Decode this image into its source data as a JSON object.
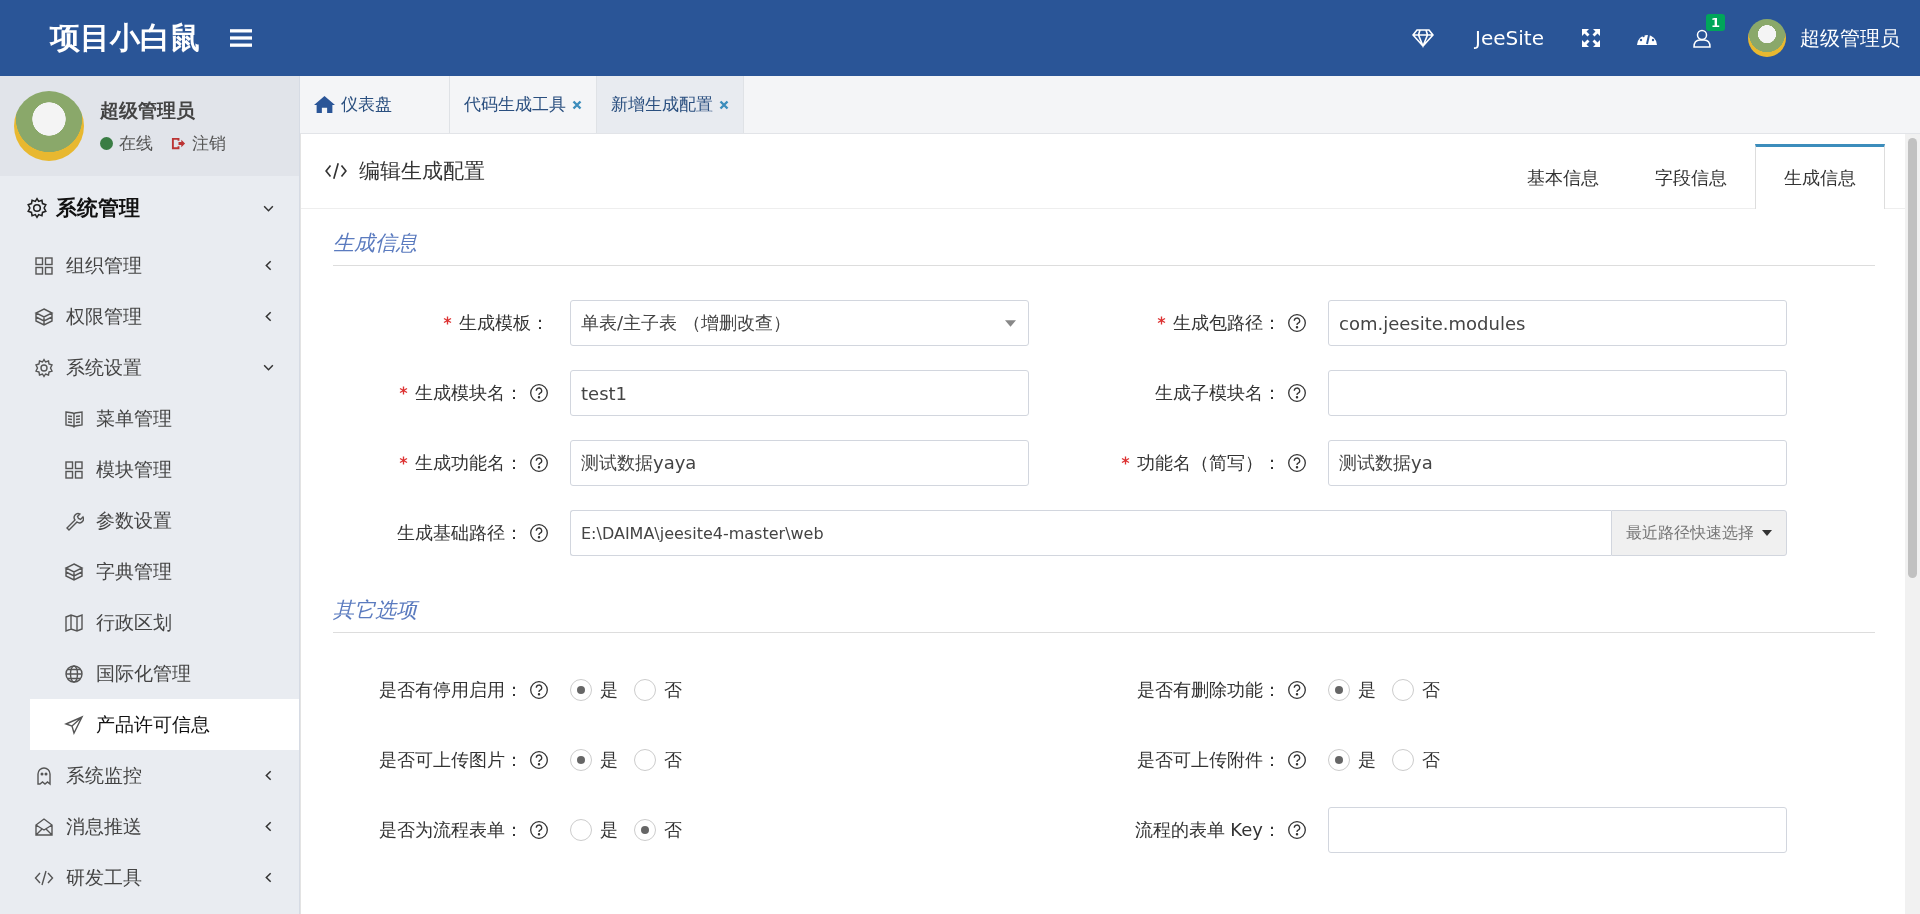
{
  "header": {
    "title": "项目小白鼠",
    "brand": "JeeSite",
    "notification_count": "1",
    "user": "超级管理员"
  },
  "user_panel": {
    "name": "超级管理员",
    "status": "在线",
    "logout": "注销"
  },
  "sidebar": {
    "items": [
      {
        "label": "系统管理",
        "expanded": true,
        "children": [
          {
            "label": "组织管理",
            "expanded": false
          },
          {
            "label": "权限管理",
            "expanded": false
          },
          {
            "label": "系统设置",
            "expanded": true,
            "children": [
              {
                "label": "菜单管理",
                "selected": false
              },
              {
                "label": "模块管理",
                "selected": false
              },
              {
                "label": "参数设置",
                "selected": false
              },
              {
                "label": "字典管理",
                "selected": false
              },
              {
                "label": "行政区划",
                "selected": false
              },
              {
                "label": "国际化管理",
                "selected": false
              },
              {
                "label": "产品许可信息",
                "selected": true
              }
            ]
          },
          {
            "label": "系统监控",
            "expanded": false
          },
          {
            "label": "消息推送",
            "expanded": false
          },
          {
            "label": "研发工具",
            "expanded": false
          }
        ]
      }
    ]
  },
  "tabs": [
    {
      "label": "仪表盘",
      "selected": false,
      "closable": false
    },
    {
      "label": "代码生成工具",
      "selected": false,
      "closable": true
    },
    {
      "label": "新增生成配置",
      "selected": true,
      "closable": true
    }
  ],
  "panel": {
    "title": "编辑生成配置",
    "tabs": [
      {
        "label": "基本信息",
        "selected": false
      },
      {
        "label": "字段信息",
        "selected": false
      },
      {
        "label": "生成信息",
        "selected": true
      }
    ]
  },
  "sections": [
    {
      "title": "生成信息",
      "fields": [
        {
          "kind": "select",
          "label": "生成模板：",
          "required": true,
          "help": false,
          "value": "单表/主子表 （增删改查）"
        },
        {
          "kind": "input",
          "label": "生成包路径：",
          "required": true,
          "help": true,
          "value": "com.jeesite.modules"
        },
        {
          "kind": "input",
          "label": "生成模块名：",
          "required": true,
          "help": true,
          "value": "test1"
        },
        {
          "kind": "input",
          "label": "生成子模块名：",
          "required": false,
          "help": true
        },
        {
          "kind": "input",
          "label": "生成功能名：",
          "required": true,
          "help": true,
          "value": "测试数据yaya"
        },
        {
          "kind": "input",
          "label": "功能名（简写）：",
          "required": true,
          "help": true,
          "value": "测试数据ya"
        },
        {
          "kind": "input-addon",
          "label": "生成基础路径：",
          "required": false,
          "help": true,
          "value": "E:\\DAIMA\\jeesite4-master\\web",
          "addon": "最近路径快速选择"
        }
      ]
    },
    {
      "title": "其它选项",
      "fields": [
        {
          "kind": "radio",
          "label": "是否有停用启用：",
          "required": false,
          "help": true,
          "options": [
            {
              "label": "是",
              "selected": true
            },
            {
              "label": "否",
              "selected": false
            }
          ]
        },
        {
          "kind": "radio",
          "label": "是否有删除功能：",
          "required": false,
          "help": true,
          "options": [
            {
              "label": "是",
              "selected": true
            },
            {
              "label": "否",
              "selected": false
            }
          ]
        },
        {
          "kind": "radio",
          "label": "是否可上传图片：",
          "required": false,
          "help": true,
          "options": [
            {
              "label": "是",
              "selected": true
            },
            {
              "label": "否",
              "selected": false
            }
          ]
        },
        {
          "kind": "radio",
          "label": "是否可上传附件：",
          "required": false,
          "help": true,
          "options": [
            {
              "label": "是",
              "selected": true
            },
            {
              "label": "否",
              "selected": false
            }
          ]
        },
        {
          "kind": "radio",
          "label": "是否为流程表单：",
          "required": false,
          "help": true,
          "options": [
            {
              "label": "是",
              "selected": false
            },
            {
              "label": "否",
              "selected": true
            }
          ]
        },
        {
          "kind": "input",
          "label": "流程的表单 Key：",
          "required": false,
          "help": true
        }
      ]
    }
  ]
}
